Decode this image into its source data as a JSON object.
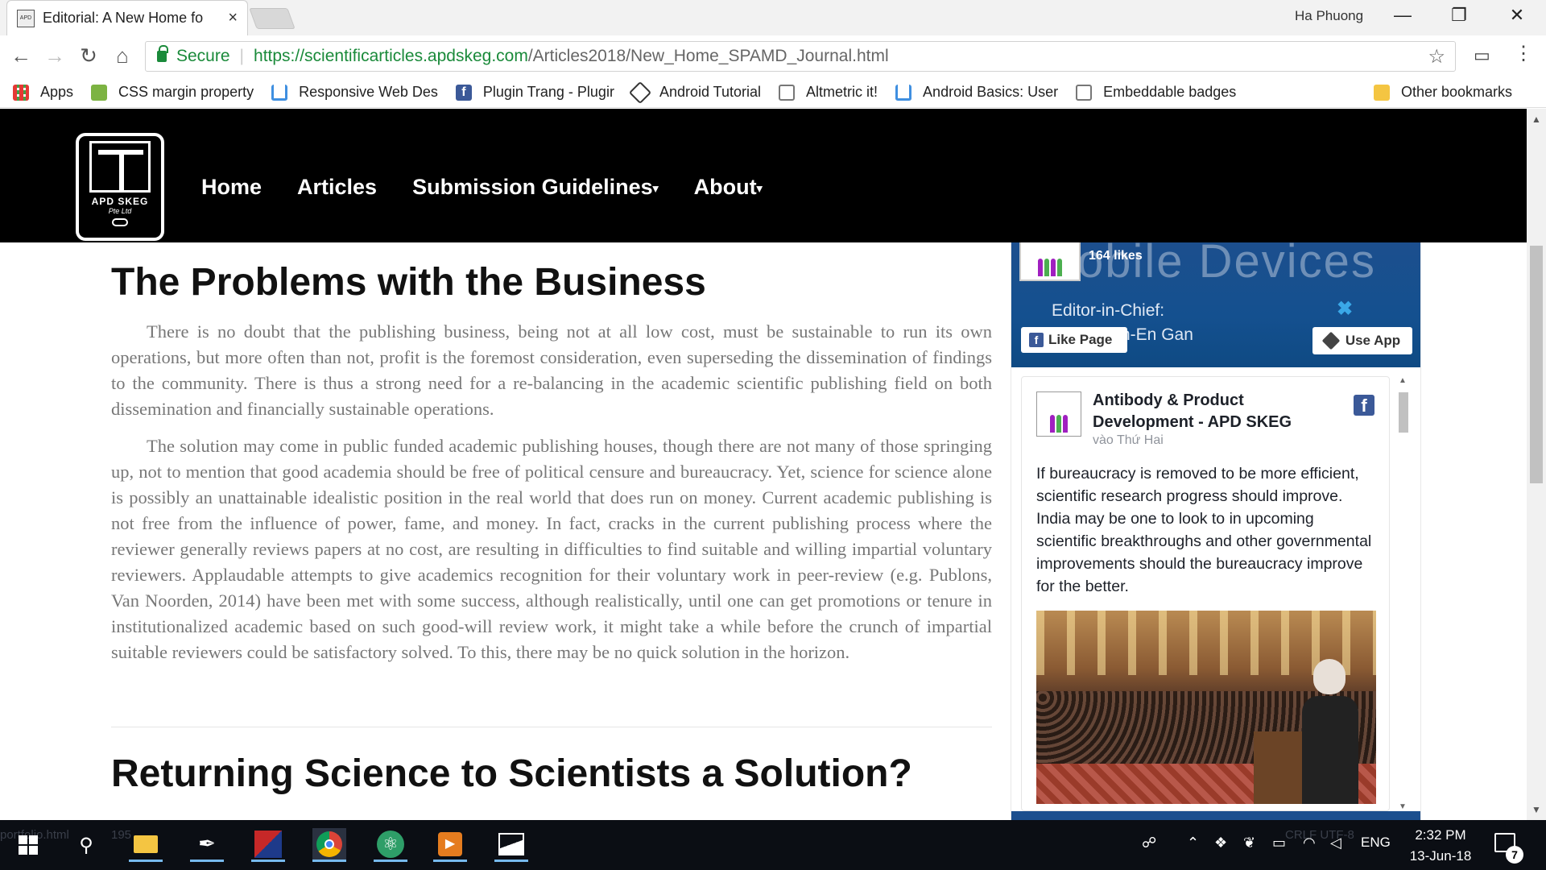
{
  "browser": {
    "tab_title": "Editorial: A New Home fo",
    "tab_close": "×",
    "profile_name": "Ha Phuong",
    "minimize": "—",
    "restore": "❐",
    "close": "✕",
    "back": "←",
    "forward": "→",
    "reload": "↻",
    "home": "⌂",
    "secure_label": "Secure",
    "url_host": "https://scientificarticles.apdskeg.com",
    "url_path": "/Articles2018/New_Home_SPAMD_Journal.html",
    "star": "☆",
    "cast": "▭",
    "menu": "⋮"
  },
  "bookmarks": [
    {
      "label": "Apps",
      "icon": "apps-grid-icon"
    },
    {
      "label": "CSS margin property",
      "icon": "w3-icon"
    },
    {
      "label": "Responsive Web Des",
      "icon": "udacity-icon"
    },
    {
      "label": "Plugin Trang - Plugir",
      "icon": "facebook-icon"
    },
    {
      "label": "Android Tutorial",
      "icon": "diamond-icon"
    },
    {
      "label": "Altmetric it!",
      "icon": "page-icon"
    },
    {
      "label": "Android Basics: User",
      "icon": "udacity-icon"
    },
    {
      "label": "Embeddable badges",
      "icon": "page-icon"
    }
  ],
  "bookmarks_other": "Other bookmarks",
  "site": {
    "logo_text": "APD SKEG",
    "logo_sub": "Pte Ltd",
    "nav": [
      "Home",
      "Articles",
      "Submission Guidelines",
      "About"
    ]
  },
  "article": {
    "heading1": "The Problems with the Business",
    "para1": "There is no doubt that the publishing business, being not at all low cost, must be sustainable to run its own operations, but more often than not, profit is the foremost consideration, even superseding the dissemination of findings to the community. There is thus a strong need for a re-balancing in the academic scientific publishing field on both dissemination and financially sustainable operations.",
    "para2": "The solution may come in public funded academic publishing houses, though there are not many of those springing up, not to mention that good academia should be free of political censure and bureaucracy. Yet, science for science alone is possibly an unattainable idealistic position in the real world that does run on money. Current academic publishing is not free from the influence of power, fame, and money. In fact, cracks in the current publishing process where the reviewer generally reviews papers at no cost, are resulting in difficulties to find suitable and willing impartial voluntary reviewers. Applaudable attempts to give academics recognition for their voluntary work in peer-review (e.g. Publons, Van Noorden, 2014) have been met with some success, although realistically, until one can get promotions or tenure in institutionalized academic based on such good-will review work, it might take a while before the crunch of impartial suitable reviewers could be satisfactory solved. To this, there may be no quick solution in the horizon.",
    "heading2": "Returning Science to Scientists a Solution?"
  },
  "sidebar": {
    "cover_title": "obile Devices",
    "likes": "164 likes",
    "editor_line1": "Editor-in-Chief:",
    "editor_line2": "Sang  Wen-En Gan",
    "like_page": "Like Page",
    "use_app": "Use App",
    "post_author": "Antibody & Product Development - APD SKEG",
    "post_time": "vào Thứ Hai",
    "post_text": "If bureaucracy is removed to be more efficient, scientific research progress should improve. India may be one to look to in upcoming scientific breakthroughs and other governmental improvements should the bureaucracy improve for the better."
  },
  "taskbar": {
    "ghost_left": "portfolio.html",
    "ghost_num": "195",
    "ghost_right": "CRLF   UTF-8",
    "lang": "ENG",
    "time": "2:32 PM",
    "date": "13-Jun-18",
    "notifications": "7"
  }
}
